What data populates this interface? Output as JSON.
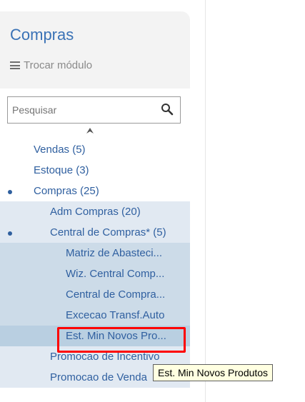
{
  "module": {
    "title": "Compras",
    "switch_label": "Trocar módulo"
  },
  "search": {
    "placeholder": "Pesquisar"
  },
  "tree": [
    {
      "label": "Vendas (5)"
    },
    {
      "label": "Estoque (3)"
    },
    {
      "label": "Compras (25)"
    },
    {
      "label": "Adm Compras (20)"
    },
    {
      "label": "Central de Compras* (5)"
    },
    {
      "label": "Matriz de Abasteci..."
    },
    {
      "label": "Wiz. Central Comp..."
    },
    {
      "label": "Central de Compra..."
    },
    {
      "label": "Excecao Transf.Auto"
    },
    {
      "label": "Est. Min Novos Pro..."
    },
    {
      "label": "Promocao de Incentivo"
    },
    {
      "label": "Promocao de Venda"
    }
  ],
  "tooltip": {
    "text": "Est. Min Novos Produtos"
  },
  "colors": {
    "accent": "#3a72b6",
    "highlight": "#ff0000",
    "tooltip_bg": "#ffffe1"
  }
}
